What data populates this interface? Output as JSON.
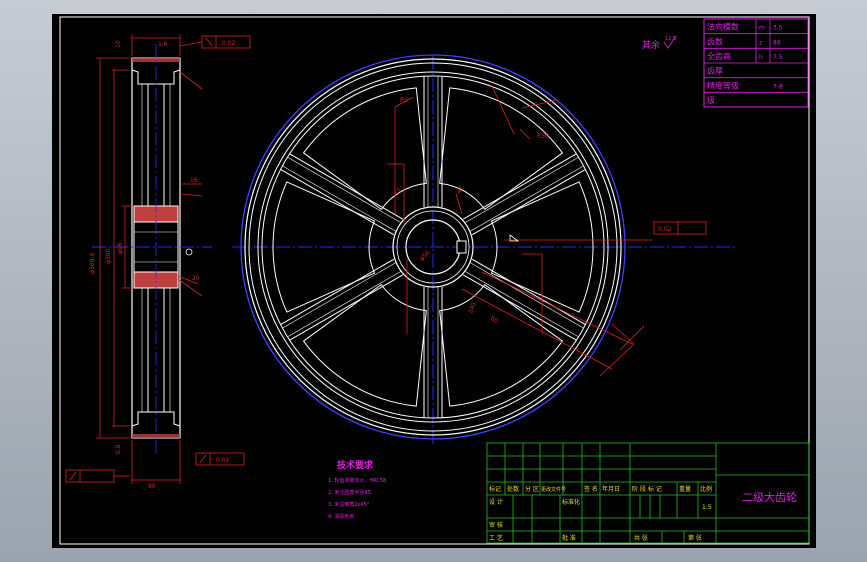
{
  "drawing_title": "二级大齿轮",
  "parameter_table": {
    "rows": [
      {
        "label": "法向模数",
        "symbol": "m",
        "value": "3.5"
      },
      {
        "label": "齿数",
        "symbol": "z",
        "value": "88"
      },
      {
        "label": "全齿高",
        "symbol": "h",
        "value": "7.5"
      },
      {
        "label": "齿厚",
        "symbol": "",
        "value": ""
      },
      {
        "label": "精度等级",
        "symbol": "",
        "value": "7-8"
      },
      {
        "label": "级",
        "symbol": "",
        "value": ""
      }
    ]
  },
  "surface_note": "其余",
  "surface_roughness": "12.5",
  "technical_requirements": {
    "title": "技术要求",
    "items": [
      "1. 轮齿渗碳淬火、HRC58",
      "2. 未注圆角半径R5",
      "3. 未注倒角2x45°",
      "4. 清除毛刺"
    ]
  },
  "title_block": {
    "marks_header": [
      "标记",
      "处数",
      "分 区",
      "更改文件号",
      "签 名",
      "年月日"
    ],
    "row_design": "设 计",
    "row_standard": "标准化",
    "row_review": "审 核",
    "row_process": "工 艺",
    "row_approve": "批 准",
    "stage_header": [
      "阶 段 标 记",
      "重量",
      "比例"
    ],
    "scale_value": "1:5",
    "sheet_total": "共   张",
    "sheet_no": "第   张"
  },
  "dimensions": {
    "outer_dia": "φ308.4",
    "tip_dia": "φ300",
    "bore_dia": "φ56",
    "hub_dia": "φ96",
    "width": "80",
    "top_mark": "10",
    "radius_label": "R5",
    "angle_label": "R10",
    "key_width": "16",
    "hub_len": "60",
    "web_size": "20",
    "rad_a": "R2",
    "tol_a": "0.02",
    "tol_b": "0.02",
    "tol_c": "0.02",
    "roughness_a": "3.2",
    "roughness_b": "1.6",
    "roughness_c": "3.2",
    "side_mark": "0.8",
    "front_a": "42",
    "front_b": "60",
    "front_c": "240",
    "front_d": "R50",
    "front_e": "12"
  }
}
